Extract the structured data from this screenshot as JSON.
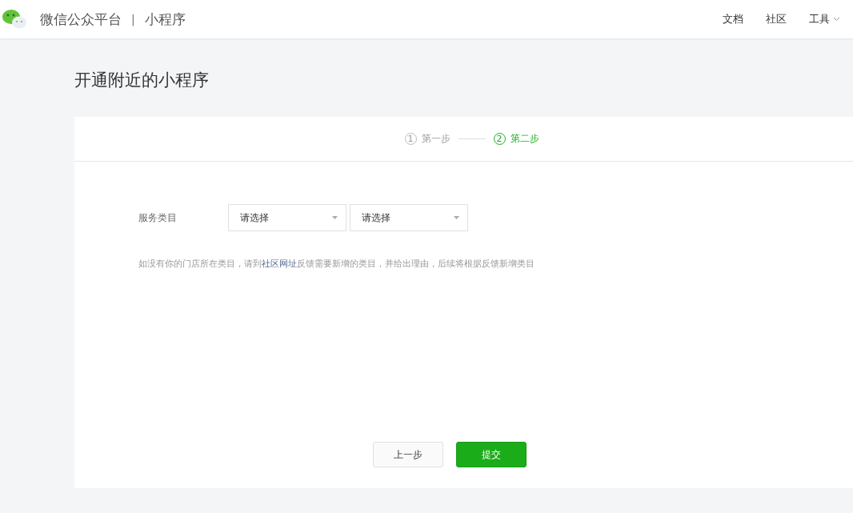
{
  "header": {
    "brand": "微信公众平台",
    "separator": "|",
    "product": "小程序",
    "nav": [
      {
        "label": "文档",
        "kind": "link"
      },
      {
        "label": "社区",
        "kind": "link"
      },
      {
        "label": "工具",
        "kind": "dropdown"
      }
    ]
  },
  "page_title": "开通附近的小程序",
  "steps": [
    {
      "number": "1",
      "label": "第一步",
      "selected": false
    },
    {
      "number": "2",
      "label": "第二步",
      "selected": true
    }
  ],
  "form": {
    "label": "服务类目",
    "selects": [
      {
        "placeholder": "请选择"
      },
      {
        "placeholder": "请选择"
      }
    ]
  },
  "hint": {
    "before": "如没有你的门店所在类目，请到",
    "link": "社区网址",
    "after": "反馈需要新增的类目，并给出理由，后续将根据反馈新增类目"
  },
  "buttons": [
    {
      "label": "上一步",
      "kind": "secondary"
    },
    {
      "label": "提交",
      "kind": "primary"
    }
  ]
}
